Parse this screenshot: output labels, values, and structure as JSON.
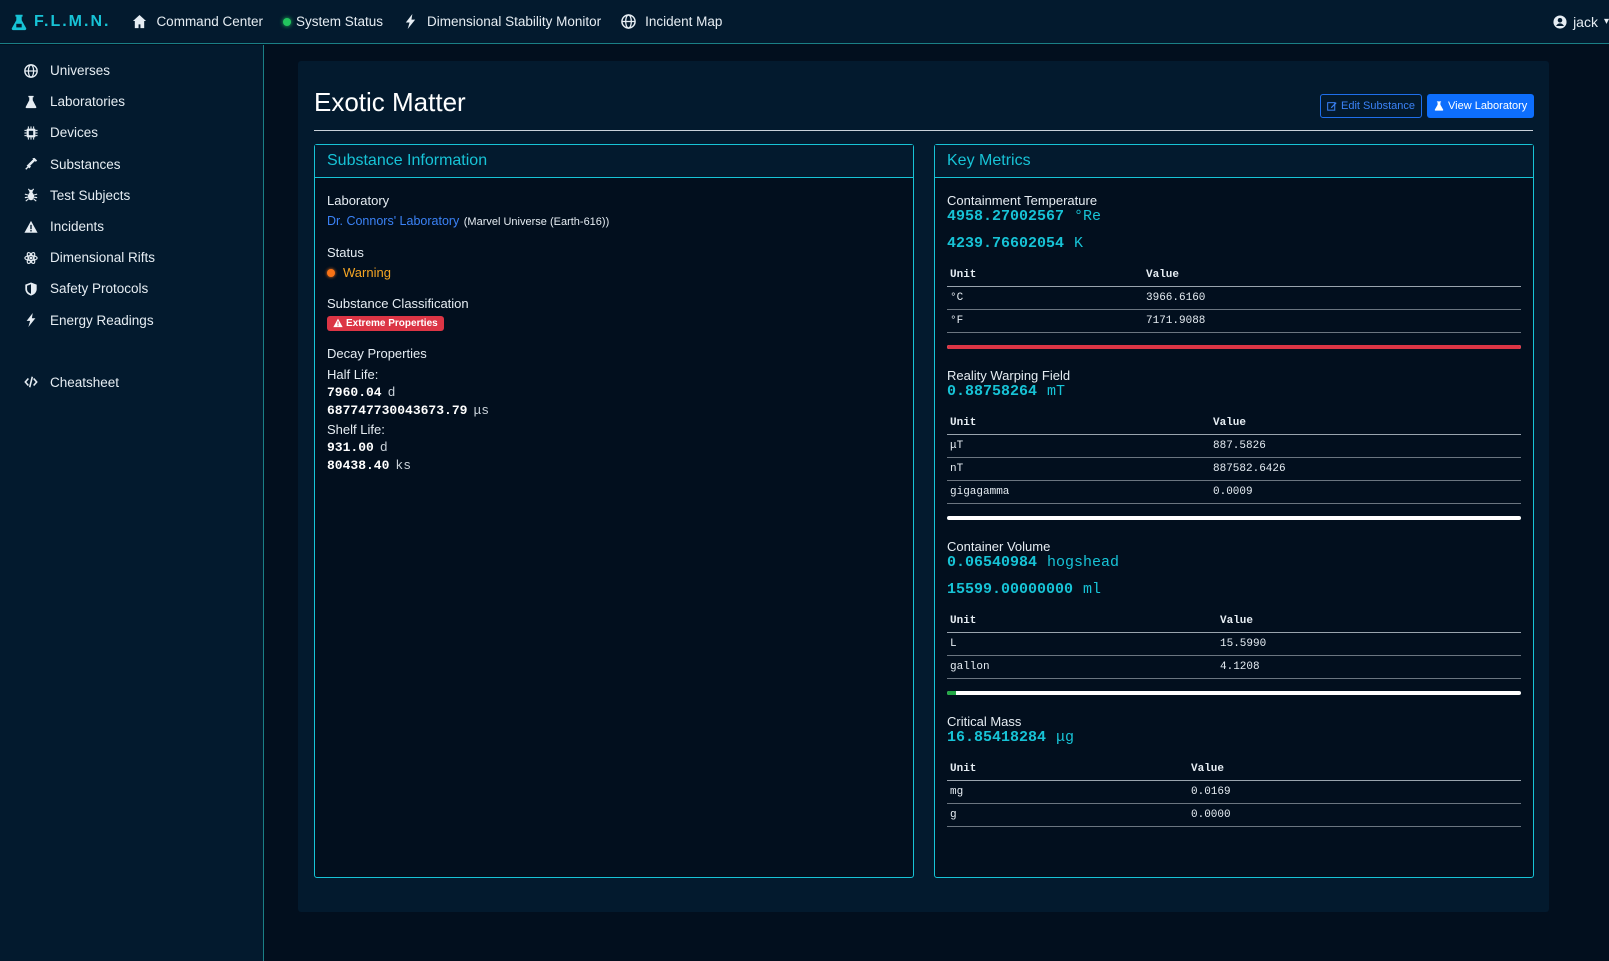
{
  "nav": {
    "brand": "F.L.M.N.",
    "items": [
      "Command Center",
      "System Status",
      "Dimensional Stability Monitor",
      "Incident Map"
    ],
    "user": "jack"
  },
  "sidebar": {
    "items": [
      "Universes",
      "Laboratories",
      "Devices",
      "Substances",
      "Test Subjects",
      "Incidents",
      "Dimensional Rifts",
      "Safety Protocols",
      "Energy Readings"
    ],
    "bottom": "Cheatsheet"
  },
  "page": {
    "title": "Exotic Matter",
    "edit_button": "Edit Substance",
    "view_button": "View Laboratory"
  },
  "info": {
    "heading": "Substance Information",
    "lab_label": "Laboratory",
    "lab_link": "Dr. Connors' Laboratory",
    "lab_universe": "(Marvel Universe (Earth-616))",
    "status_label": "Status",
    "status_value": "Warning",
    "class_label": "Substance Classification",
    "class_badge": "Extreme Properties",
    "decay_label": "Decay Properties",
    "half_life_label": "Half Life:",
    "half_life": [
      {
        "value": "7960.04",
        "unit": "d"
      },
      {
        "value": "687747730043673.79",
        "unit": "μs"
      }
    ],
    "shelf_life_label": "Shelf Life:",
    "shelf_life": [
      {
        "value": "931.00",
        "unit": "d"
      },
      {
        "value": "80438.40",
        "unit": "ks"
      }
    ]
  },
  "metrics": {
    "heading": "Key Metrics",
    "unit_header": "Unit",
    "value_header": "Value",
    "temperature": {
      "title": "Containment Temperature",
      "primary": {
        "value": "4958.27002567",
        "unit": "°Re"
      },
      "secondary": {
        "value": "4239.76602054",
        "unit": "K"
      },
      "rows": [
        {
          "unit": "°C",
          "value": "3966.6160"
        },
        {
          "unit": "°F",
          "value": "7171.9088"
        }
      ],
      "bar_fraction": 1.0,
      "bar_color": "#dc3545"
    },
    "field": {
      "title": "Reality Warping Field",
      "primary": {
        "value": "0.88758264",
        "unit": "mT"
      },
      "rows": [
        {
          "unit": "μT",
          "value": "887.5826"
        },
        {
          "unit": "nT",
          "value": "887582.6426"
        },
        {
          "unit": "gigagamma",
          "value": "0.0009"
        }
      ],
      "bar_fraction": 0.0,
      "bar_color": "#ffffff"
    },
    "volume": {
      "title": "Container Volume",
      "primary": {
        "value": "0.06540984",
        "unit": "hogshead"
      },
      "secondary": {
        "value": "15599.00000000",
        "unit": "ml"
      },
      "rows": [
        {
          "unit": "L",
          "value": "15.5990"
        },
        {
          "unit": "gallon",
          "value": "4.1208"
        }
      ],
      "bar_fraction": 0.015,
      "bar_color": "#22a845"
    },
    "mass": {
      "title": "Critical Mass",
      "primary": {
        "value": "16.85418284",
        "unit": "μg"
      },
      "rows": [
        {
          "unit": "mg",
          "value": "0.0169"
        },
        {
          "unit": "g",
          "value": "0.0000"
        }
      ]
    }
  }
}
